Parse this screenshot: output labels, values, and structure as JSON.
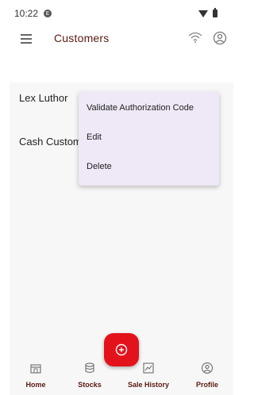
{
  "status_bar": {
    "time": "10:22",
    "notification_badge": "E"
  },
  "app_bar": {
    "title": "Customers",
    "icons": [
      "menu-icon",
      "wifi-icon",
      "profile-icon"
    ]
  },
  "customers": [
    {
      "name": "Lex Luthor"
    },
    {
      "name": "Cash Customer"
    }
  ],
  "context_menu": {
    "items": [
      {
        "label": "Validate Authorization Code"
      },
      {
        "label": "Edit"
      },
      {
        "label": "Delete"
      }
    ]
  },
  "bottom_nav": {
    "items": [
      {
        "label": "Home",
        "icon": "store-icon"
      },
      {
        "label": "Stocks",
        "icon": "database-icon"
      },
      {
        "label": "Sale History",
        "icon": "chart-icon"
      },
      {
        "label": "Profile",
        "icon": "profile-icon"
      }
    ]
  },
  "fab": {
    "icon": "add-icon"
  },
  "colors": {
    "accent": "#e3131b",
    "title": "#5a1a12",
    "menu_bg": "#efe8f6"
  }
}
